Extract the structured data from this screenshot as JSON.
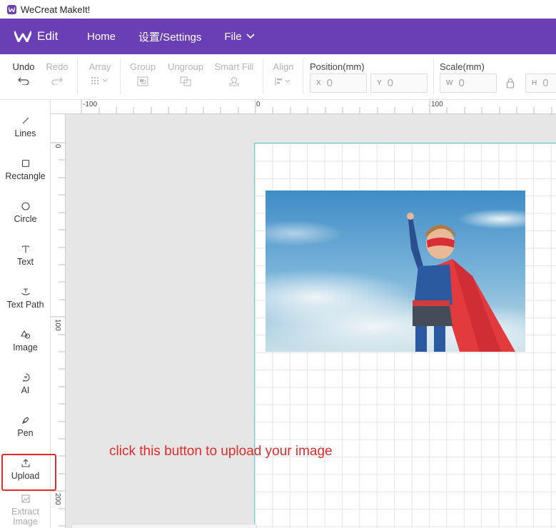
{
  "window": {
    "title": "WeCreat MakeIt!"
  },
  "menubar": {
    "brand": "Edit",
    "items": [
      "Home",
      "设置/Settings",
      "File"
    ]
  },
  "toolbar": {
    "undo": "Undo",
    "redo": "Redo",
    "array": "Array",
    "group": "Group",
    "ungroup": "Ungroup",
    "smart_fill": "Smart Fill",
    "align": "Align",
    "position_label": "Position(mm)",
    "x_key": "X",
    "x_value": "0",
    "y_key": "Y",
    "y_value": "0",
    "scale_label": "Scale(mm)",
    "w_key": "W",
    "w_value": "0",
    "h_key": "H",
    "h_value": "0"
  },
  "tools": [
    "Lines",
    "Rectangle",
    "Circle",
    "Text",
    "Text Path",
    "Image",
    "AI",
    "Pen",
    "Upload",
    "Extract",
    "Image"
  ],
  "rulers": {
    "horizontal": [
      "-100",
      "0",
      "100"
    ],
    "vertical": [
      "0",
      "100",
      "200"
    ]
  },
  "annotation": "click this button to upload your image",
  "colors": {
    "brand": "#6a3fb5",
    "highlight": "#e52a2a",
    "board_edge": "#5ad0c4"
  }
}
